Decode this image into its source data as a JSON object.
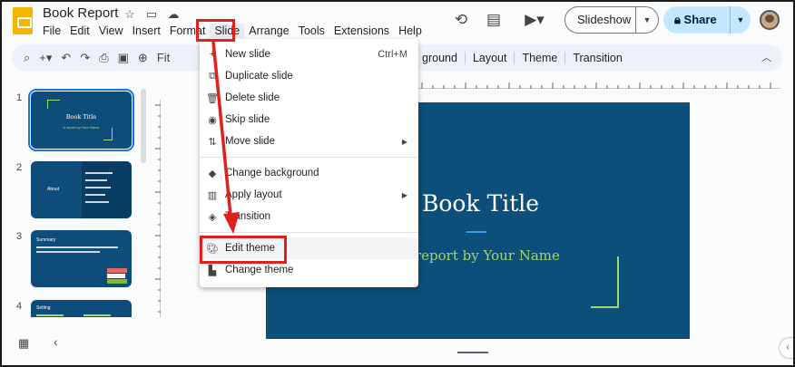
{
  "doc": {
    "title": "Book Report"
  },
  "menu": {
    "items": [
      "File",
      "Edit",
      "View",
      "Insert",
      "Format",
      "Slide",
      "Arrange",
      "Tools",
      "Extensions",
      "Help"
    ],
    "active": "Slide"
  },
  "header": {
    "slideshow_label": "Slideshow",
    "share_label": "Share"
  },
  "toolbar": {
    "fit_label": "Fit",
    "background_label": "ground",
    "layout_label": "Layout",
    "theme_label": "Theme",
    "transition_label": "Transition"
  },
  "slide_menu": {
    "items": [
      {
        "label": "New slide",
        "shortcut": "Ctrl+M",
        "icon": "plus-icon"
      },
      {
        "label": "Duplicate slide",
        "icon": "duplicate-icon"
      },
      {
        "label": "Delete slide",
        "icon": "trash-icon"
      },
      {
        "label": "Skip slide",
        "icon": "eye-off-icon"
      },
      {
        "label": "Move slide",
        "icon": "move-icon",
        "submenu": true
      },
      {
        "label": "Change background",
        "icon": "paint-bucket-icon"
      },
      {
        "label": "Apply layout",
        "icon": "layout-icon",
        "submenu": true
      },
      {
        "label": "Transition",
        "icon": "transition-icon"
      },
      {
        "label": "Edit theme",
        "icon": "palette-icon",
        "highlighted": true
      },
      {
        "label": "Change theme",
        "icon": "paint-roller-icon"
      }
    ]
  },
  "thumbnails": [
    {
      "number": "1",
      "title": "Book Title",
      "subtitle": "A report by Your Name"
    },
    {
      "number": "2",
      "title": "About"
    },
    {
      "number": "3",
      "title": "Summary"
    },
    {
      "number": "4",
      "title": "Setting"
    }
  ],
  "slide": {
    "title": "Book Title",
    "subtitle": "report by Your Name",
    "background_color": "#0b4f7a",
    "accent_color": "#a4d46b"
  },
  "colors": {
    "annotation_red": "#e0201a",
    "share_bg": "#c2e7ff"
  }
}
